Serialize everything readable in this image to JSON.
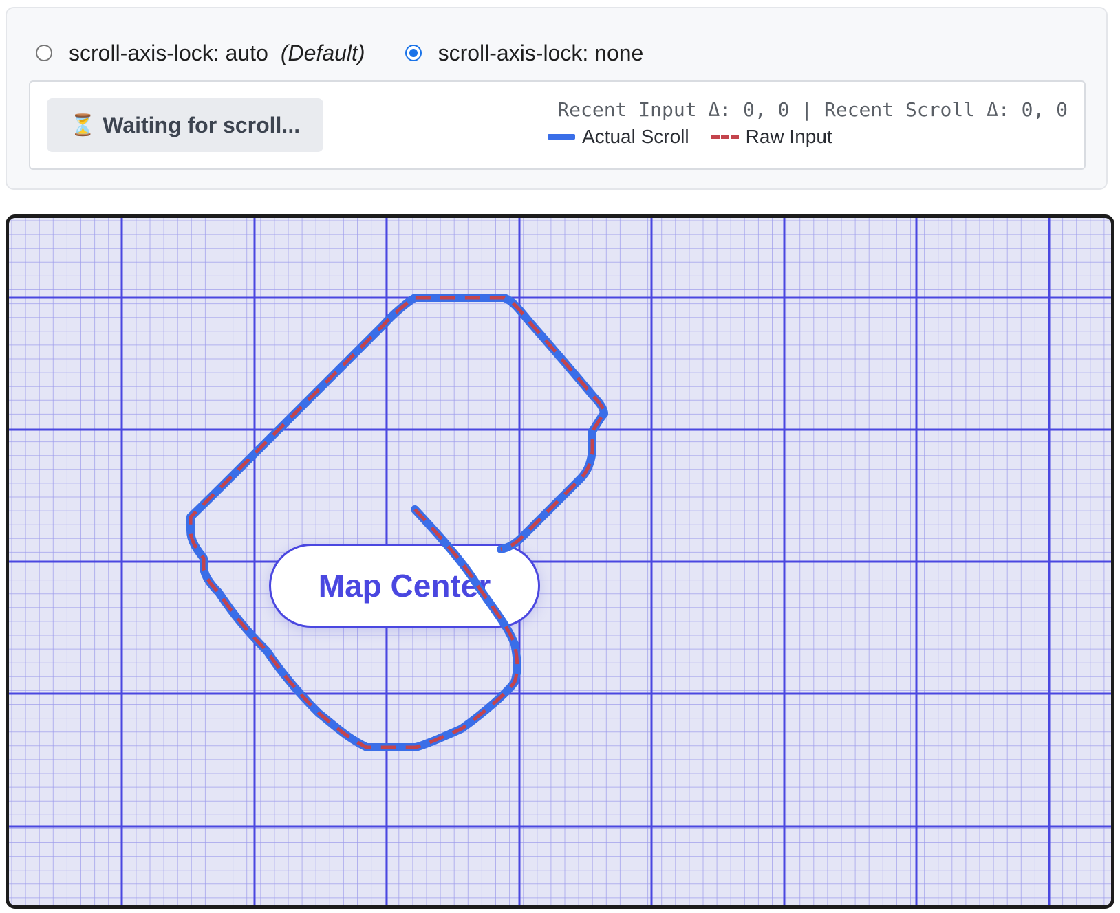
{
  "controls": {
    "options": [
      {
        "label": "scroll-axis-lock: auto",
        "note": "(Default)",
        "checked": false
      },
      {
        "label": "scroll-axis-lock: none",
        "note": "",
        "checked": true
      }
    ]
  },
  "status": {
    "icon": "hourglass-icon",
    "message": "Waiting for scroll...",
    "readout": "Recent Input Δ: 0, 0 | Recent Scroll Δ: 0, 0",
    "legend": {
      "actual_label": "Actual Scroll",
      "raw_label": "Raw Input"
    }
  },
  "map": {
    "center_label": "Map Center",
    "colors": {
      "background": "#e4e5f6",
      "major_grid": "#4a47e0",
      "minor_grid": "#9d9cec",
      "actual_path": "#3a6ee8",
      "raw_path": "#c4444c"
    }
  }
}
